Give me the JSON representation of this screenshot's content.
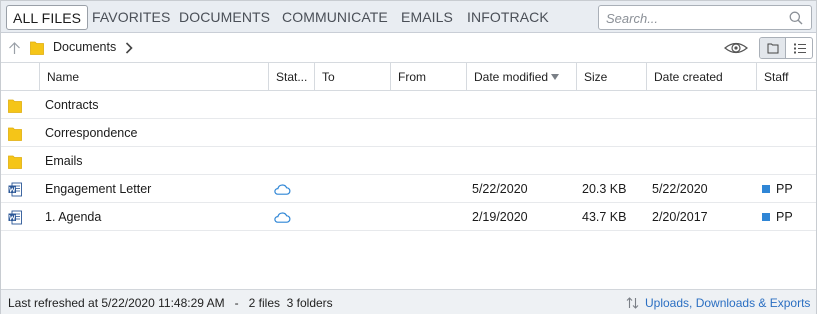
{
  "tabs": [
    {
      "label": "ALL FILES",
      "active": true
    },
    {
      "label": "FAVORITES",
      "active": false
    },
    {
      "label": "DOCUMENTS",
      "active": false
    },
    {
      "label": "COMMUNICATE",
      "active": false
    },
    {
      "label": "EMAILS",
      "active": false
    },
    {
      "label": "INFOTRACK",
      "active": false
    }
  ],
  "search": {
    "placeholder": "Search...",
    "value": "",
    "icon": "search-icon"
  },
  "breadcrumb": {
    "current": "Documents"
  },
  "columns": [
    "Name",
    "Stat...",
    "To",
    "From",
    "Date modified",
    "Size",
    "Date created",
    "Staff"
  ],
  "sorted_column": "Date modified",
  "rows": [
    {
      "type": "folder",
      "icon": "folder-icon",
      "name": "Contracts",
      "status": "",
      "to": "",
      "from": "",
      "date_modified": "",
      "size": "",
      "date_created": "",
      "staff": ""
    },
    {
      "type": "folder",
      "icon": "folder-icon",
      "name": "Correspondence",
      "status": "",
      "to": "",
      "from": "",
      "date_modified": "",
      "size": "",
      "date_created": "",
      "staff": ""
    },
    {
      "type": "folder",
      "icon": "folder-icon",
      "name": "Emails",
      "status": "",
      "to": "",
      "from": "",
      "date_modified": "",
      "size": "",
      "date_created": "",
      "staff": ""
    },
    {
      "type": "word",
      "icon": "word-document-icon",
      "name": "Engagement Letter",
      "status": "cloud-icon",
      "to": "",
      "from": "",
      "date_modified": "5/22/2020",
      "size": "20.3 KB",
      "date_created": "5/22/2020",
      "staff": "PP"
    },
    {
      "type": "word",
      "icon": "word-document-icon",
      "name": "1. Agenda",
      "status": "cloud-icon",
      "to": "",
      "from": "",
      "date_modified": "2/19/2020",
      "size": "43.7 KB",
      "date_created": "2/20/2017",
      "staff": "PP"
    }
  ],
  "status": {
    "refreshed": "Last refreshed at 5/22/2020 11:48:29 AM",
    "separator": "-",
    "counts": "2 files  3 folders",
    "uploads_link": "Uploads, Downloads & Exports"
  },
  "colors": {
    "folder": "#f5c518",
    "word_blue": "#2b5797",
    "cloud_blue": "#2f86d6",
    "staff_square": "#2f86d6",
    "link": "#2b6fc2",
    "tabbar_bg": "#e9edf2"
  }
}
